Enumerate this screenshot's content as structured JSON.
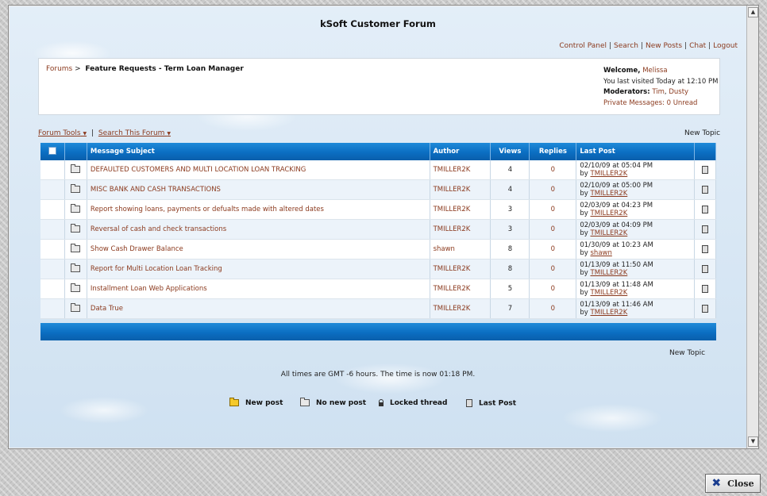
{
  "forum_title": "kSoft Customer Forum",
  "top_links": {
    "control_panel": "Control Panel",
    "search": "Search",
    "new_posts": "New Posts",
    "chat": "Chat",
    "logout": "Logout",
    "separator": "|"
  },
  "breadcrumb": {
    "forums": "Forums",
    "arrow": ">",
    "current": "Feature Requests - Term Loan Manager"
  },
  "user_box": {
    "welcome_label": "Welcome,",
    "username": "Melissa",
    "last_visited": "You last visited Today at 12:10 PM",
    "moderators_label": "Moderators:",
    "moderator_1": "Tim",
    "moderator_sep": ",",
    "moderator_2": "Dusty",
    "private_messages": "Private Messages: 0 Unread"
  },
  "tools": {
    "forum_tools": "Forum Tools",
    "separator": "|",
    "search_forum": "Search This Forum"
  },
  "new_topic_label": "New Topic",
  "table": {
    "headers": {
      "subject": "Message Subject",
      "author": "Author",
      "views": "Views",
      "replies": "Replies",
      "last_post": "Last Post"
    },
    "rows": [
      {
        "subject": "DEFAULTED CUSTOMERS AND MULTI LOCATION LOAN TRACKING",
        "author": "TMILLER2K",
        "views": "4",
        "replies": "0",
        "date": "02/10/09 at 05:04 PM",
        "by": "TMILLER2K"
      },
      {
        "subject": "MISC BANK AND CASH TRANSACTIONS",
        "author": "TMILLER2K",
        "views": "4",
        "replies": "0",
        "date": "02/10/09 at 05:00 PM",
        "by": "TMILLER2K"
      },
      {
        "subject": "Report showing loans, payments or defualts made with altered dates",
        "author": "TMILLER2K",
        "views": "3",
        "replies": "0",
        "date": "02/03/09 at 04:23 PM",
        "by": "TMILLER2K"
      },
      {
        "subject": "Reversal of cash and check transactions",
        "author": "TMILLER2K",
        "views": "3",
        "replies": "0",
        "date": "02/03/09 at 04:09 PM",
        "by": "TMILLER2K"
      },
      {
        "subject": "Show Cash Drawer Balance",
        "author": "shawn",
        "views": "8",
        "replies": "0",
        "date": "01/30/09 at 10:23 AM",
        "by": "shawn"
      },
      {
        "subject": "Report for Multi Location Loan Tracking",
        "author": "TMILLER2K",
        "views": "8",
        "replies": "0",
        "date": "01/13/09 at 11:50 AM",
        "by": "TMILLER2K"
      },
      {
        "subject": "Installment Loan Web Applications",
        "author": "TMILLER2K",
        "views": "5",
        "replies": "0",
        "date": "01/13/09 at 11:48 AM",
        "by": "TMILLER2K"
      },
      {
        "subject": "Data True",
        "author": "TMILLER2K",
        "views": "7",
        "replies": "0",
        "date": "01/13/09 at 11:46 AM",
        "by": "TMILLER2K"
      }
    ],
    "by_label": "by"
  },
  "timezone_text": "All times are GMT -6 hours. The time is now 01:18 PM.",
  "legend": {
    "new_post": "New post",
    "no_new_post": "No new post",
    "locked_thread": "Locked thread",
    "last_post": "Last Post"
  },
  "close_button": "Close",
  "colors": {
    "link": "#8b3a1e",
    "header_blue": "#0b6ec2",
    "row_alt": "#ecf3fa"
  }
}
